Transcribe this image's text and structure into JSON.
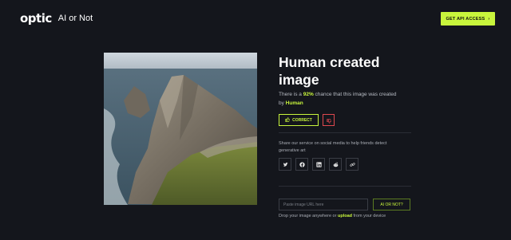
{
  "header": {
    "logo_text": "optic",
    "logo_subtitle": "AI or Not",
    "api_button_label": "GET API ACCESS",
    "api_button_icon": "arrow-right-icon"
  },
  "result": {
    "verdict": "Human created image",
    "desc_prefix": "There is a ",
    "percent": "92%",
    "desc_mid": " chance that this image was created by ",
    "source": "Human",
    "correct_label": "CORRECT",
    "correct_icon": "thumbs-up-icon",
    "incorrect_icon": "thumbs-down-icon"
  },
  "share": {
    "text": "Share our service on social media to help friends detect generative art",
    "icons": [
      "twitter-icon",
      "facebook-icon",
      "linkedin-icon",
      "reddit-icon",
      "link-icon"
    ]
  },
  "upload": {
    "url_placeholder": "Paste image URL here",
    "check_button_label": "AI OR NOT?",
    "drop_prefix": "Drop your image anywhere or ",
    "upload_link": "upload",
    "drop_suffix": " from your device"
  },
  "colors": {
    "accent": "#c8f53c",
    "background": "#14161c",
    "danger": "#e0484f"
  }
}
